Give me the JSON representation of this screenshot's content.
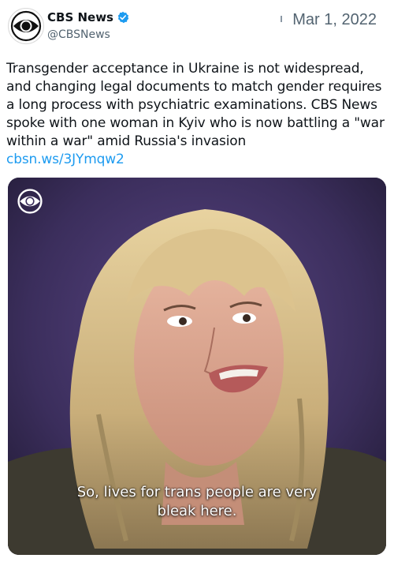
{
  "tweet": {
    "author_name": "CBS News",
    "author_handle": "@CBSNews",
    "date": "Mar 1, 2022",
    "text": "Transgender acceptance in Ukraine is not widespread, and changing legal documents to match gender requires a long process with psychiatric examinations. CBS News spoke with one woman in Kyiv who is now battling a \"war within a war\" amid Russia's invasion",
    "link": "cbsn.ws/3JYmqw2",
    "verified": true
  },
  "media": {
    "caption_line1": "So, lives for trans people are very",
    "caption_line2": "bleak here.",
    "overlay_logo": "cbs-eye-icon"
  },
  "colors": {
    "link": "#1d9bf0",
    "verified_badge": "#1d9bf0",
    "secondary_text": "#536471",
    "video_background": "#3b2e5c"
  }
}
